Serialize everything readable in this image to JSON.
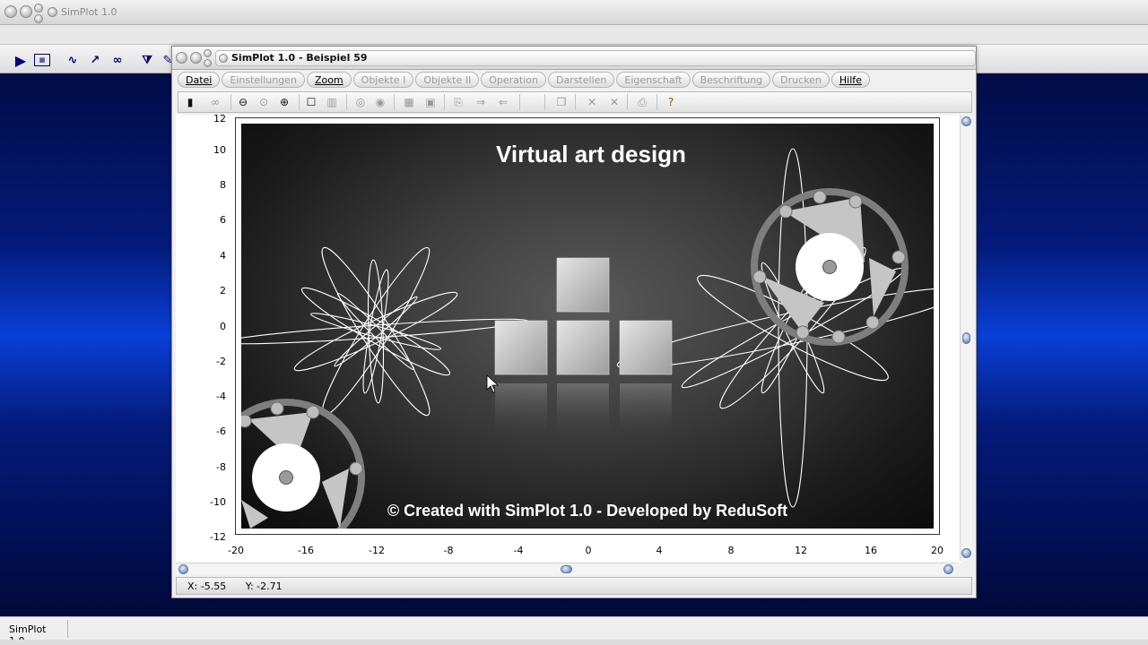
{
  "app": {
    "title": "SimPlot 1.0",
    "taskbar_label": "SimPlot 1.0"
  },
  "window": {
    "title": "SimPlot 1.0 - Beispiel 59",
    "menus": [
      {
        "label": "Datei",
        "active": true
      },
      {
        "label": "Einstellungen",
        "active": false
      },
      {
        "label": "Zoom",
        "active": true
      },
      {
        "label": "Objekte I",
        "active": false
      },
      {
        "label": "Objekte II",
        "active": false
      },
      {
        "label": "Operation",
        "active": false
      },
      {
        "label": "Darstellen",
        "active": false
      },
      {
        "label": "Eigenschaft",
        "active": false
      },
      {
        "label": "Beschriftung",
        "active": false
      },
      {
        "label": "Drucken",
        "active": false
      },
      {
        "label": "Hilfe",
        "active": true
      }
    ]
  },
  "plot": {
    "title": "Virtual art design",
    "footer": "© Created with SimPlot 1.0 - Developed by ReduSoft",
    "y_ticks": [
      "12",
      "10",
      "8",
      "6",
      "4",
      "2",
      "0",
      "-2",
      "-4",
      "-6",
      "-8",
      "-10",
      "-12"
    ],
    "x_ticks": [
      "-20",
      "-16",
      "-12",
      "-8",
      "-4",
      "0",
      "4",
      "8",
      "12",
      "16",
      "20"
    ]
  },
  "coords": {
    "x": "X:  -5.55",
    "y": "Y:  -2.71"
  },
  "colors": {
    "accent": "#0a3fd6",
    "plot_bg": "#3d3d3d",
    "curve": "#ffffff"
  }
}
